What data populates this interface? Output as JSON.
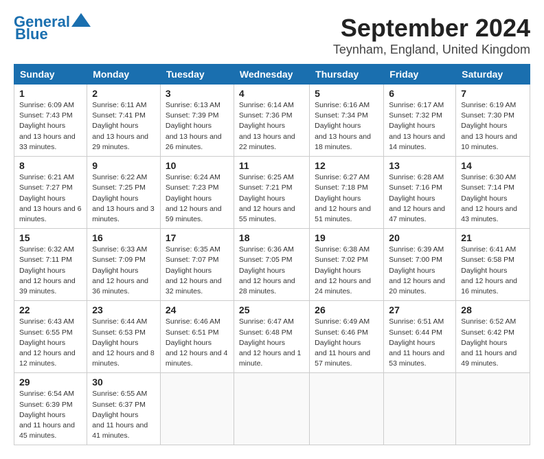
{
  "logo": {
    "line1": "General",
    "line2": "Blue"
  },
  "title": "September 2024",
  "subtitle": "Teynham, England, United Kingdom",
  "days_of_week": [
    "Sunday",
    "Monday",
    "Tuesday",
    "Wednesday",
    "Thursday",
    "Friday",
    "Saturday"
  ],
  "weeks": [
    [
      {
        "day": 1,
        "sunrise": "6:09 AM",
        "sunset": "7:43 PM",
        "daylight": "13 hours and 33 minutes."
      },
      {
        "day": 2,
        "sunrise": "6:11 AM",
        "sunset": "7:41 PM",
        "daylight": "13 hours and 29 minutes."
      },
      {
        "day": 3,
        "sunrise": "6:13 AM",
        "sunset": "7:39 PM",
        "daylight": "13 hours and 26 minutes."
      },
      {
        "day": 4,
        "sunrise": "6:14 AM",
        "sunset": "7:36 PM",
        "daylight": "13 hours and 22 minutes."
      },
      {
        "day": 5,
        "sunrise": "6:16 AM",
        "sunset": "7:34 PM",
        "daylight": "13 hours and 18 minutes."
      },
      {
        "day": 6,
        "sunrise": "6:17 AM",
        "sunset": "7:32 PM",
        "daylight": "13 hours and 14 minutes."
      },
      {
        "day": 7,
        "sunrise": "6:19 AM",
        "sunset": "7:30 PM",
        "daylight": "13 hours and 10 minutes."
      }
    ],
    [
      {
        "day": 8,
        "sunrise": "6:21 AM",
        "sunset": "7:27 PM",
        "daylight": "13 hours and 6 minutes."
      },
      {
        "day": 9,
        "sunrise": "6:22 AM",
        "sunset": "7:25 PM",
        "daylight": "13 hours and 3 minutes."
      },
      {
        "day": 10,
        "sunrise": "6:24 AM",
        "sunset": "7:23 PM",
        "daylight": "12 hours and 59 minutes."
      },
      {
        "day": 11,
        "sunrise": "6:25 AM",
        "sunset": "7:21 PM",
        "daylight": "12 hours and 55 minutes."
      },
      {
        "day": 12,
        "sunrise": "6:27 AM",
        "sunset": "7:18 PM",
        "daylight": "12 hours and 51 minutes."
      },
      {
        "day": 13,
        "sunrise": "6:28 AM",
        "sunset": "7:16 PM",
        "daylight": "12 hours and 47 minutes."
      },
      {
        "day": 14,
        "sunrise": "6:30 AM",
        "sunset": "7:14 PM",
        "daylight": "12 hours and 43 minutes."
      }
    ],
    [
      {
        "day": 15,
        "sunrise": "6:32 AM",
        "sunset": "7:11 PM",
        "daylight": "12 hours and 39 minutes."
      },
      {
        "day": 16,
        "sunrise": "6:33 AM",
        "sunset": "7:09 PM",
        "daylight": "12 hours and 36 minutes."
      },
      {
        "day": 17,
        "sunrise": "6:35 AM",
        "sunset": "7:07 PM",
        "daylight": "12 hours and 32 minutes."
      },
      {
        "day": 18,
        "sunrise": "6:36 AM",
        "sunset": "7:05 PM",
        "daylight": "12 hours and 28 minutes."
      },
      {
        "day": 19,
        "sunrise": "6:38 AM",
        "sunset": "7:02 PM",
        "daylight": "12 hours and 24 minutes."
      },
      {
        "day": 20,
        "sunrise": "6:39 AM",
        "sunset": "7:00 PM",
        "daylight": "12 hours and 20 minutes."
      },
      {
        "day": 21,
        "sunrise": "6:41 AM",
        "sunset": "6:58 PM",
        "daylight": "12 hours and 16 minutes."
      }
    ],
    [
      {
        "day": 22,
        "sunrise": "6:43 AM",
        "sunset": "6:55 PM",
        "daylight": "12 hours and 12 minutes."
      },
      {
        "day": 23,
        "sunrise": "6:44 AM",
        "sunset": "6:53 PM",
        "daylight": "12 hours and 8 minutes."
      },
      {
        "day": 24,
        "sunrise": "6:46 AM",
        "sunset": "6:51 PM",
        "daylight": "12 hours and 4 minutes."
      },
      {
        "day": 25,
        "sunrise": "6:47 AM",
        "sunset": "6:48 PM",
        "daylight": "12 hours and 1 minute."
      },
      {
        "day": 26,
        "sunrise": "6:49 AM",
        "sunset": "6:46 PM",
        "daylight": "11 hours and 57 minutes."
      },
      {
        "day": 27,
        "sunrise": "6:51 AM",
        "sunset": "6:44 PM",
        "daylight": "11 hours and 53 minutes."
      },
      {
        "day": 28,
        "sunrise": "6:52 AM",
        "sunset": "6:42 PM",
        "daylight": "11 hours and 49 minutes."
      }
    ],
    [
      {
        "day": 29,
        "sunrise": "6:54 AM",
        "sunset": "6:39 PM",
        "daylight": "11 hours and 45 minutes."
      },
      {
        "day": 30,
        "sunrise": "6:55 AM",
        "sunset": "6:37 PM",
        "daylight": "11 hours and 41 minutes."
      },
      null,
      null,
      null,
      null,
      null
    ]
  ]
}
